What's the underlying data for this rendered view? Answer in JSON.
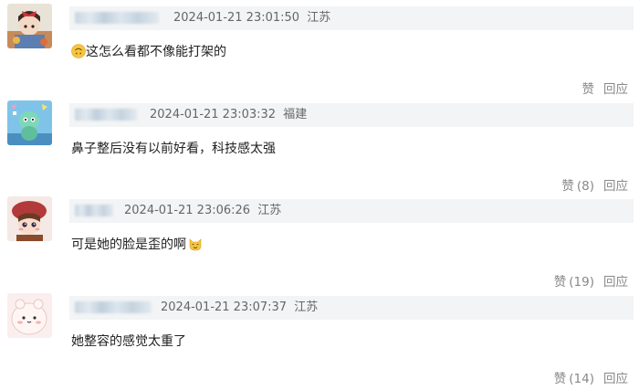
{
  "comments": [
    {
      "username_blurred": true,
      "timestamp": "2024-01-21 23:01:50",
      "location": "江苏",
      "text": "这怎么看都不像能打架的",
      "leading_emoji": "upside-down-face-emoji",
      "trailing_emoji": "",
      "like_label": "赞",
      "like_count": "",
      "reply_label": "回应"
    },
    {
      "username_blurred": true,
      "timestamp": "2024-01-21 23:03:32",
      "location": "福建",
      "text": "鼻子整后没有以前好看，科技感太强",
      "leading_emoji": "",
      "trailing_emoji": "",
      "like_label": "赞",
      "like_count": "(8)",
      "reply_label": "回应"
    },
    {
      "username_blurred": true,
      "timestamp": "2024-01-21 23:06:26",
      "location": "江苏",
      "text": "可是她的脸是歪的啊",
      "leading_emoji": "",
      "trailing_emoji": "cat-face-emoji",
      "like_label": "赞",
      "like_count": "(19)",
      "reply_label": "回应"
    },
    {
      "username_blurred": true,
      "timestamp": "2024-01-21 23:07:37",
      "location": "江苏",
      "text": "她整容的感觉太重了",
      "leading_emoji": "",
      "trailing_emoji": "",
      "like_label": "赞",
      "like_count": "(14)",
      "reply_label": "回应"
    }
  ],
  "colors": {
    "meta_bar_bg": "#f2f4f5",
    "meta_text": "#666666",
    "action_text": "#888888",
    "content_text": "#222222"
  }
}
